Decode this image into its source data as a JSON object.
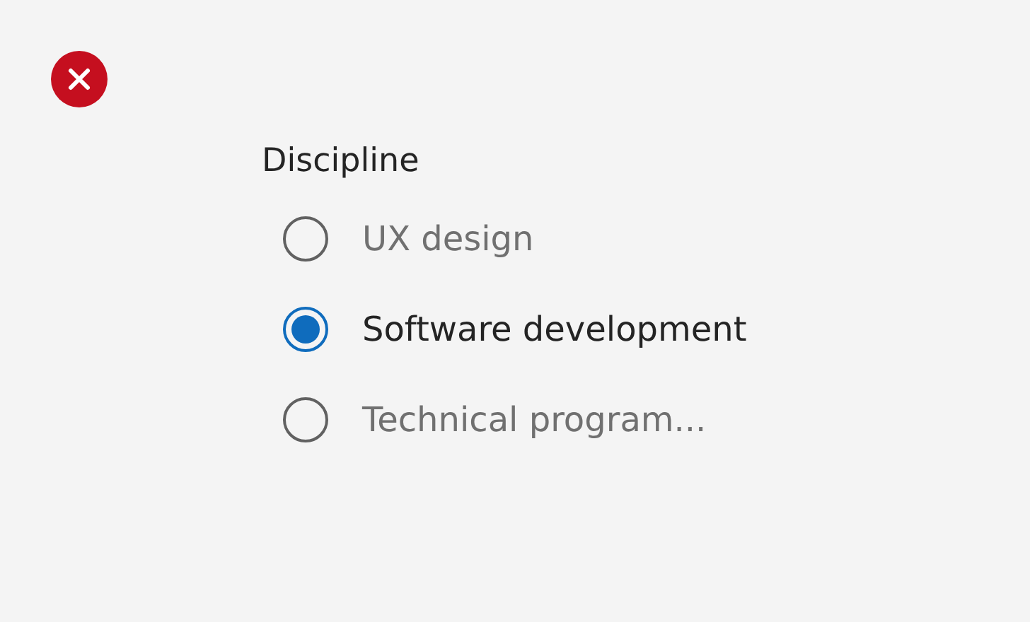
{
  "error_indicator": {
    "shown": true
  },
  "radio_group": {
    "label": "Discipline",
    "options": [
      {
        "label": "UX design",
        "selected": false
      },
      {
        "label": "Software development",
        "selected": true
      },
      {
        "label": "Technical program...",
        "selected": false
      }
    ]
  }
}
